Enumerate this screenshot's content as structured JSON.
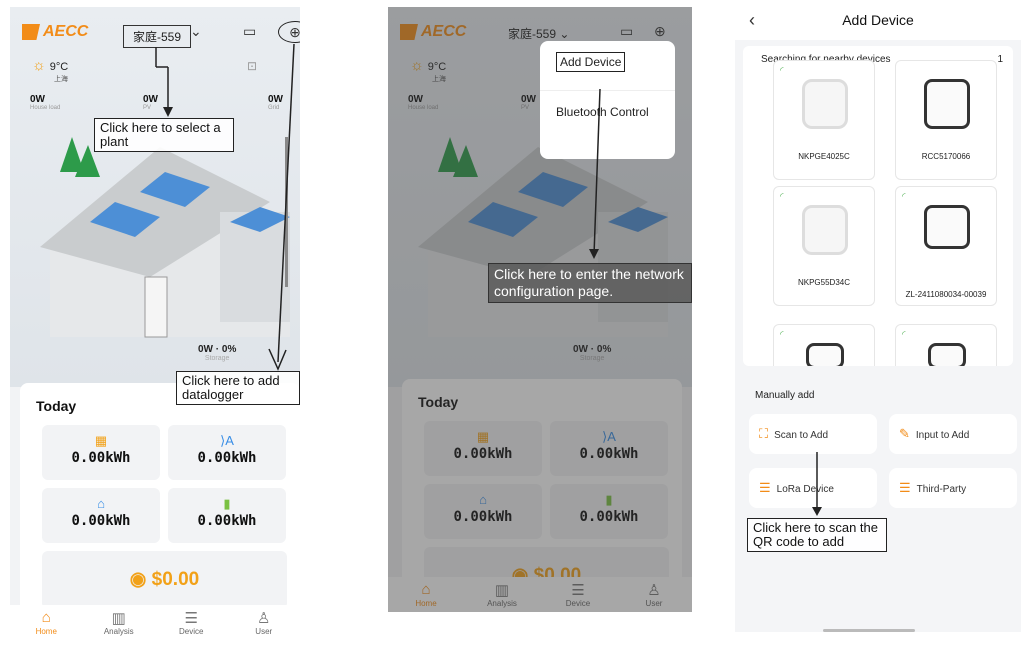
{
  "home": {
    "logo_text": "AECC",
    "plant_name": "家庭-559",
    "weather": {
      "temp": "9°C",
      "city": "上海"
    },
    "flows": [
      {
        "value": "0W",
        "label": "House load"
      },
      {
        "value": "0W",
        "label": "PV"
      },
      {
        "value": "0W",
        "label": "Grid"
      }
    ],
    "storage": {
      "value": "0W · 0%",
      "label": "Storage"
    },
    "today_label": "Today",
    "tiles": [
      "0.00kWh",
      "0.00kWh",
      "0.00kWh",
      "0.00kWh"
    ],
    "money": "$0.00",
    "nav": [
      "Home",
      "Analysis",
      "Device",
      "User"
    ]
  },
  "popup": {
    "items": [
      "Add Device",
      "Bluetooth Control"
    ]
  },
  "add_device": {
    "title": "Add Device",
    "search_title": "Searching for nearby devices",
    "count": "1",
    "devices": [
      "NKPGE4025C",
      "RCC5170066",
      "NKPG55D34C",
      "ZL-2411080034-00039"
    ],
    "manual_label": "Manually add",
    "buttons": [
      "Scan to Add",
      "Input to Add",
      "LoRa Device",
      "Third-Party"
    ]
  },
  "annotations": {
    "select_plant": "Click here to select a plant",
    "add_datalogger": "Click here to add datalogger",
    "network_config": "Click here to enter the network configuration page.",
    "scan_qr": "Click here to scan the QR code to add"
  },
  "colors": {
    "accent": "#f28c18",
    "money": "#f2a118",
    "wifi": "#4caf50"
  }
}
